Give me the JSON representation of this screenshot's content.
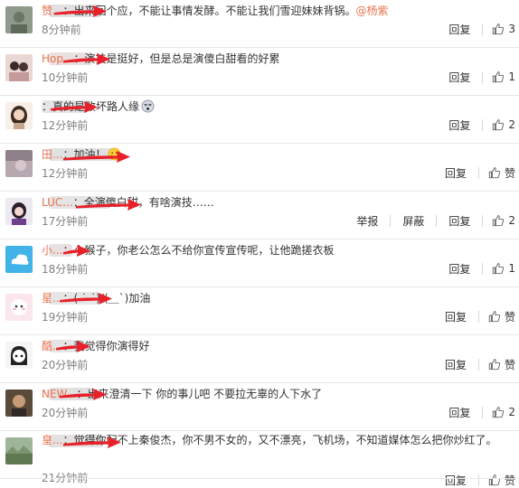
{
  "labels": {
    "reply": "回复",
    "like": "赞",
    "report": "举报",
    "block": "屏蔽"
  },
  "colors": {
    "username": "#eb7350",
    "time": "#808080",
    "arrow": "#e8202a",
    "separator": "#e8e8e8"
  },
  "comments": [
    {
      "username": "赞...",
      "text": "：出来回个应，不能让事情发酵。不能让我们雪迎妹妹背锅。",
      "mention": "@杨紫",
      "time": "8分钟前",
      "likes": "3",
      "avatar_icon": "avatar-gray-icon"
    },
    {
      "username": "Hop...",
      "text": "：演技是挺好，但是总是演傻白甜看的好累",
      "time": "10分钟前",
      "likes": "1",
      "avatar_icon": "avatar-couple-icon"
    },
    {
      "username": "",
      "text": "：真的是败坏路人缘",
      "emoji_icon": "dizzy-face-emoji-icon",
      "time": "12分钟前",
      "likes": "2",
      "avatar_icon": "avatar-girl-icon"
    },
    {
      "username": "田...",
      "text": "：加油！",
      "emoji_icon": "smile-emoji-icon",
      "time": "12分钟前",
      "likes": "",
      "avatar_icon": "avatar-photo-icon"
    },
    {
      "username": "LUC...",
      "text": "：全演傻白甜，有啥演技……",
      "time": "17分钟前",
      "likes": "2",
      "show_report": true,
      "avatar_icon": "avatar-woman-icon"
    },
    {
      "username": "小...",
      "text": "：小猴子，你老公怎么不给你宣传宣传呢，让他跪搓衣板",
      "time": "18分钟前",
      "likes": "1",
      "avatar_icon": "avatar-cloud-icon"
    },
    {
      "username": "星...",
      "text": "：( ˙-˙)/(＿ˋ)加油",
      "time": "19分钟前",
      "likes": "",
      "avatar_icon": "avatar-pink-cartoon-icon"
    },
    {
      "username": "酷...",
      "text": "：我觉得你演得好",
      "time": "20分钟前",
      "likes": "",
      "avatar_icon": "avatar-cartoon-girl-icon"
    },
    {
      "username": "NEW...",
      "text": "：出来澄清一下 你的事儿吧  不要拉无辜的人下水了",
      "time": "20分钟前",
      "likes": "2",
      "avatar_icon": "avatar-man-icon"
    },
    {
      "username": "皇...",
      "text": "：觉得你配不上秦俊杰，你不男不女的，又不漂亮，飞机场，不知道媒体怎么把你炒红了。",
      "time": "21分钟前",
      "likes": "",
      "avatar_icon": "avatar-landscape-icon"
    }
  ]
}
